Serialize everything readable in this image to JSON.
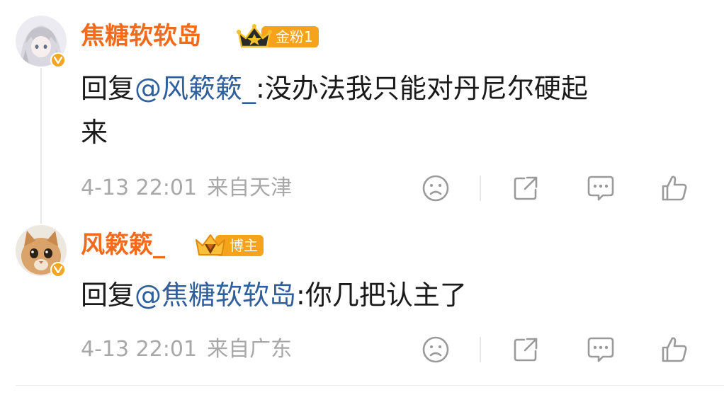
{
  "comments": [
    {
      "username": "焦糖软软岛",
      "rank": "金粉1",
      "reply_prefix": "回复",
      "mention": "@风簌簌_",
      "text_line1": ":没办法我只能对丹尼尔硬起",
      "text_line2": "来",
      "time": "4-13 22:01",
      "location": "来自天津",
      "rank_color": "#f7a21b"
    },
    {
      "username": "风簌簌_",
      "rank": "博主",
      "reply_prefix": "回复",
      "mention": "@焦糖软软岛",
      "text_line1": ":你几把认主了",
      "time": "4-13 22:01",
      "location": "来自广东",
      "rank_color": "#f7a21b"
    }
  ]
}
